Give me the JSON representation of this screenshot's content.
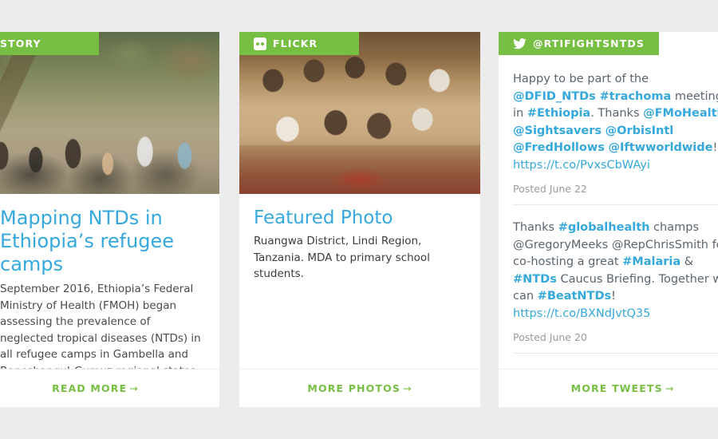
{
  "theme": {
    "accent_green": "#76bf43",
    "link_blue": "#35a8dd",
    "page_background": "#ececec",
    "card_background": "#ffffff",
    "body_text": "#4a4a4a",
    "muted_text": "#9a9a9a"
  },
  "cards": {
    "story": {
      "badge_label": "STORY",
      "headline": "Mapping NTDs in Ethiopia’s refugee camps",
      "excerpt": "September 2016, Ethiopia’s Federal Ministry of Health (FMOH) began assessing the prevalence of neglected tropical diseases (NTDs) in all refugee camps in Gambella and Beneshangul-Gumuz regional states.",
      "footer_label": "READ MORE",
      "footer_arrow": "→",
      "image_alt": "group-walking-village-street"
    },
    "flickr": {
      "badge_label": "FLICKR",
      "badge_icon": "flickr-icon",
      "headline": "Featured Photo",
      "caption": "Ruangwa District, Lindi Region, Tanzania. MDA to primary school students.",
      "footer_label": "MORE PHOTOS",
      "footer_arrow": "→",
      "image_alt": "schoolchildren-at-desks"
    },
    "tweets": {
      "badge_label": "@RTIFIGHTSNTDS",
      "badge_icon": "twitter-bird-icon",
      "footer_label": "MORE TWEETS",
      "footer_arrow": "→",
      "items": [
        {
          "segments": [
            {
              "text": "Happy to be part of the ",
              "kind": "plain"
            },
            {
              "text": "@DFID_NTDs",
              "kind": "link"
            },
            {
              "text": " ",
              "kind": "plain"
            },
            {
              "text": "#trachoma",
              "kind": "link"
            },
            {
              "text": " meeting in ",
              "kind": "plain"
            },
            {
              "text": "#Ethiopia",
              "kind": "link"
            },
            {
              "text": ". Thanks ",
              "kind": "plain"
            },
            {
              "text": "@FMoHealth",
              "kind": "link"
            },
            {
              "text": " ",
              "kind": "plain"
            },
            {
              "text": "@Sightsavers",
              "kind": "link"
            },
            {
              "text": " ",
              "kind": "plain"
            },
            {
              "text": "@OrbisIntl",
              "kind": "link"
            },
            {
              "text": " ",
              "kind": "plain"
            },
            {
              "text": "@FredHollows",
              "kind": "link"
            },
            {
              "text": " ",
              "kind": "plain"
            },
            {
              "text": "@Iftwworldwide",
              "kind": "link"
            },
            {
              "text": "! ",
              "kind": "plain"
            },
            {
              "text": "https://t.co/PvxsCbWAyi",
              "kind": "url"
            }
          ],
          "posted": "Posted June 22"
        },
        {
          "segments": [
            {
              "text": "Thanks ",
              "kind": "plain"
            },
            {
              "text": "#globalhealth",
              "kind": "link"
            },
            {
              "text": " champs @GregoryMeeks @RepChrisSmith for co-hosting a great ",
              "kind": "plain"
            },
            {
              "text": "#Malaria",
              "kind": "link"
            },
            {
              "text": " & ",
              "kind": "plain"
            },
            {
              "text": "#NTDs",
              "kind": "link"
            },
            {
              "text": " Caucus Briefing. Together we can ",
              "kind": "plain"
            },
            {
              "text": "#BeatNTDs",
              "kind": "link"
            },
            {
              "text": "! ",
              "kind": "plain"
            },
            {
              "text": "https://t.co/BXNdJvtQ35",
              "kind": "url"
            }
          ],
          "posted": "Posted June 20"
        }
      ]
    }
  }
}
